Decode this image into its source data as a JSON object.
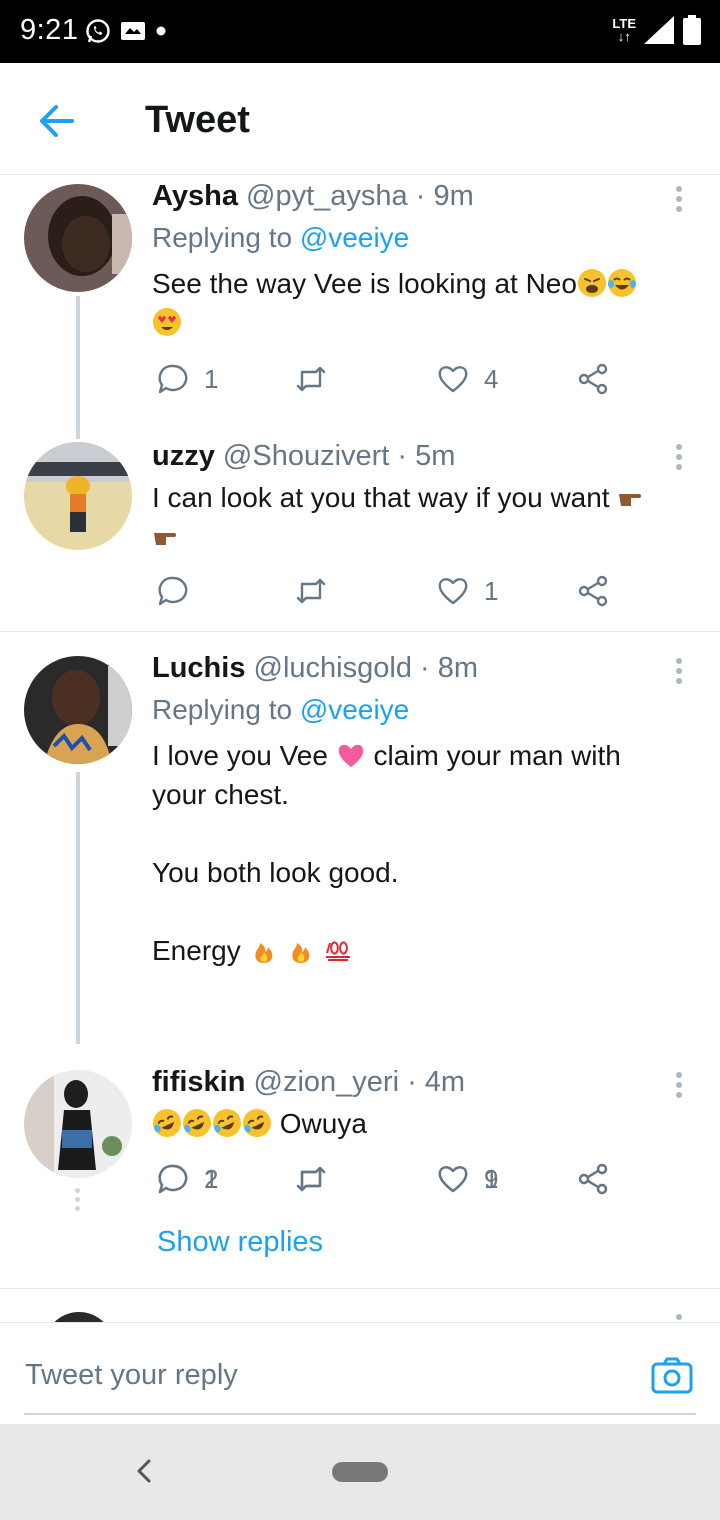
{
  "status_bar": {
    "time": "9:21",
    "network": "LTE"
  },
  "header": {
    "title": "Tweet"
  },
  "tweets": [
    {
      "name": "Aysha",
      "handle": "@pyt_aysha",
      "time": "· 9m",
      "replying_prefix": "Replying to ",
      "replying_to": "@veeiye",
      "text": "See the way Vee is looking at Neo",
      "replies": "1",
      "retweets": "",
      "likes": "4"
    },
    {
      "name": "uzzy",
      "handle": "@Shouzivert",
      "time": "· 5m",
      "text": "I can look at you that way if you want",
      "replies": "",
      "retweets": "",
      "likes": "1"
    },
    {
      "name": "Luchis",
      "handle": "@luchisgold",
      "time": "· 8m",
      "replying_prefix": "Replying to ",
      "replying_to": "@veeiye",
      "text_line1a": "I love you Vee",
      "text_line1b": " claim your man with",
      "text_line2": "your chest.",
      "text_line3": "You both look good.",
      "text_line4": "Energy",
      "replies": "2",
      "retweets": "",
      "likes": "9"
    },
    {
      "name": "fifiskin",
      "handle": "@zion_yeri",
      "time": "· 4m",
      "text": "Owuya",
      "replies": "1",
      "retweets": "",
      "likes": "1"
    }
  ],
  "show_replies": "Show replies",
  "composer": {
    "placeholder": "Tweet your reply"
  }
}
